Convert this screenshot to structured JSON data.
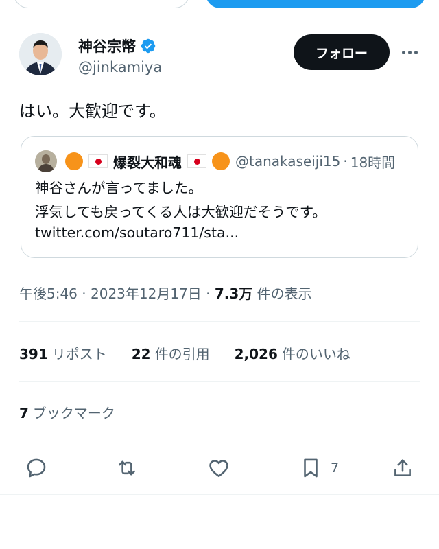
{
  "author": {
    "name": "神谷宗幣",
    "handle": "@jinkamiya",
    "follow_label": "フォロー"
  },
  "tweet": {
    "text": "はい。大歓迎です。"
  },
  "quote": {
    "name": "爆裂大和魂",
    "handle": "@tanakaseiji15",
    "separator": "·",
    "time": "18時間",
    "lines": [
      "神谷さんが言ってました。",
      "浮気しても戻ってくる人は大歓迎だそうです。",
      "twitter.com/soutaro711/sta..."
    ]
  },
  "meta": {
    "time": "午後5:46",
    "sep1": "·",
    "date": "2023年12月17日",
    "sep2": "·",
    "views": "7.3万",
    "views_label": "件の表示"
  },
  "stats": {
    "reposts": "391",
    "reposts_label": "リポスト",
    "quotes": "22",
    "quotes_label": "件の引用",
    "likes": "2,026",
    "likes_label": "件のいいね"
  },
  "bookmarks": {
    "count": "7",
    "label": "ブックマーク"
  },
  "actions": {
    "bookmark_count": "7",
    "icons": [
      "reply-icon",
      "repost-icon",
      "like-icon",
      "bookmark-icon",
      "share-icon"
    ]
  },
  "colors": {
    "verified": "#1d9bf0",
    "follow_bg": "#0f1419",
    "secondary_text": "#536471",
    "badge_orange": "#f7931a",
    "flag_red": "#d7001d"
  }
}
